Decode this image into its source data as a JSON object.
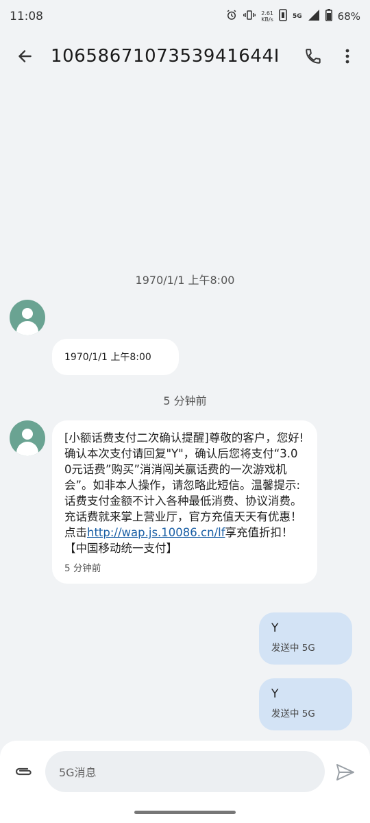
{
  "status": {
    "time": "11:08",
    "net_speed": "2.61",
    "net_unit": "KB/s",
    "network": "5G",
    "battery": "68%"
  },
  "header": {
    "title": "1065867107353941644I",
    "back_icon": "arrow-left-icon",
    "call_icon": "phone-icon",
    "more_icon": "more-vert-icon"
  },
  "conversation": {
    "date_sep_1": "1970/1/1 上午8:00",
    "msg1": {
      "text": "1970/1/1 上午8:00"
    },
    "date_sep_2": "5 分钟前",
    "msg2": {
      "text_before": "[小额话费支付二次确认提醒]尊敬的客户，您好!确认本次支付请回复\"Y\"，确认后您将支付“3.00元话费”购买”消消闯关赢话费的一次游戏机会”。如非本人操作，请忽略此短信。温馨提示:话费支付金额不计入各种最低消费、协议消费。充话费就来掌上营业厅，官方充值天天有优惠！点击",
      "link": "http://wap.js.10086.cn/lf",
      "text_after": "享充值折扣！ 【中国移动统一支付】",
      "time": "5 分钟前"
    },
    "sent": [
      {
        "text": "Y",
        "status": "发送中 5G"
      },
      {
        "text": "Y",
        "status": "发送中 5G"
      }
    ]
  },
  "composer": {
    "placeholder": "5G消息",
    "attach_icon": "paperclip-icon",
    "send_icon": "send-icon"
  },
  "colors": {
    "background": "#f1f3f5",
    "avatar": "#6aa392",
    "outgoing_bubble": "#d3e3f5",
    "incoming_bubble": "#ffffff",
    "link": "#1a5fa5"
  }
}
